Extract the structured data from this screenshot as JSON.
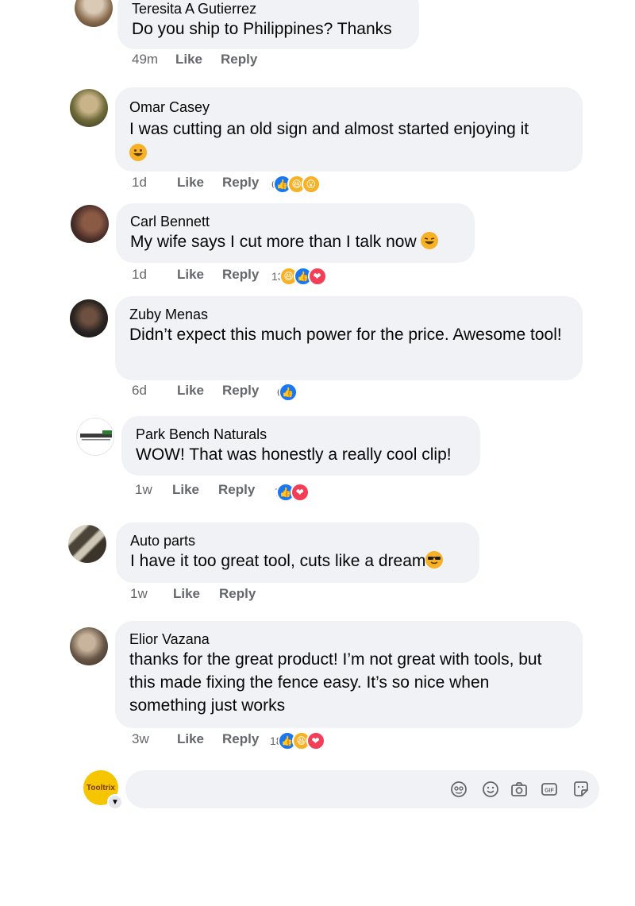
{
  "comments": [
    {
      "author": "Teresita A Gutierrez",
      "text": "Do you ship to Philippines? Thanks",
      "time": "49m",
      "like": "Like",
      "reply": "Reply",
      "reaction_count": "",
      "reactions": []
    },
    {
      "author": "Omar Casey",
      "text": "I was cutting an old sign and almost started enjoying it",
      "time": "1d",
      "like": "Like",
      "reply": "Reply",
      "reaction_count": "6",
      "reactions": [
        "like-icon",
        "haha-icon",
        "wow-icon"
      ]
    },
    {
      "author": "Carl Bennett",
      "text": "My wife says I cut more than I talk now",
      "time": "1d",
      "like": "Like",
      "reply": "Reply",
      "reaction_count": "13",
      "reactions": [
        "haha-icon",
        "like-icon",
        "love-icon"
      ]
    },
    {
      "author": "Zuby Menas",
      "text": "Didn’t expect this much power for the price. Awesome tool!",
      "time": "6d",
      "like": "Like",
      "reply": "Reply",
      "reaction_count": "6",
      "reactions": [
        "like-icon"
      ]
    },
    {
      "author": "Park Bench Naturals",
      "text": "WOW! That was honestly a really cool clip!",
      "time": "1w",
      "like": "Like",
      "reply": "Reply",
      "reaction_count": "7",
      "reactions": [
        "like-icon",
        "love-icon"
      ]
    },
    {
      "author": "Auto parts",
      "text": "I have it too great tool, cuts like a dream",
      "time": "1w",
      "like": "Like",
      "reply": "Reply",
      "reaction_count": "",
      "reactions": []
    },
    {
      "author": "Elior Vazana",
      "text": "thanks for the great product! I’m not great with tools, but this made fixing the fence easy. It’s so nice when something just works",
      "time": "3w",
      "like": "Like",
      "reply": "Reply",
      "reaction_count": "18",
      "reactions": [
        "like-icon",
        "haha-icon",
        "love-icon"
      ]
    }
  ],
  "composer": {
    "page_avatar_text": "Tooltrix",
    "placeholder": "",
    "icons": [
      "avatar-sticker-icon",
      "emoji-icon",
      "camera-icon",
      "gif-icon",
      "sticker-icon"
    ]
  },
  "page_avatars": {
    "park_bench_logo_text": "Park Bench Naturals"
  },
  "colors": {
    "bubble": "#f0f2f5",
    "meta_text": "#65676b",
    "like_blue": "#1877f2",
    "haha_yellow": "#f7b125",
    "love_red": "#f33e58"
  }
}
